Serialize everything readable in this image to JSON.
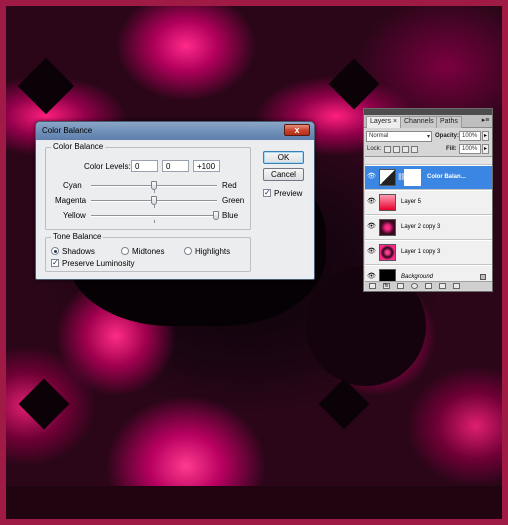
{
  "dialog": {
    "title": "Color Balance",
    "close_symbol": "x",
    "color_balance_group": "Color Balance",
    "color_levels_label": "Color Levels:",
    "levels": [
      "0",
      "0",
      "+100"
    ],
    "sliders": [
      {
        "left": "Cyan",
        "right": "Red",
        "value": 0
      },
      {
        "left": "Magenta",
        "right": "Green",
        "value": 0
      },
      {
        "left": "Yellow",
        "right": "Blue",
        "value": 100
      }
    ],
    "tone_balance_group": "Tone Balance",
    "tones": [
      {
        "label": "Shadows",
        "selected": true
      },
      {
        "label": "Midtones",
        "selected": false
      },
      {
        "label": "Highlights",
        "selected": false
      }
    ],
    "preserve_luminosity": {
      "label": "Preserve Luminosity",
      "checked": true
    },
    "buttons": {
      "ok": "OK",
      "cancel": "Cancel"
    },
    "preview": {
      "label": "Preview",
      "checked": true
    }
  },
  "layers_panel": {
    "tabs": [
      {
        "label": "Layers",
        "active": true
      },
      {
        "label": "Channels",
        "active": false
      },
      {
        "label": "Paths",
        "active": false
      }
    ],
    "menu_symbol": "▸≡",
    "blend_mode": "Normal",
    "opacity_label": "Opacity:",
    "opacity_value": "100%",
    "lock_label": "Lock:",
    "fill_label": "Fill:",
    "fill_value": "100%",
    "layers": [
      {
        "name": "Color Balan...",
        "selected": true,
        "thumb": "adjustment"
      },
      {
        "name": "Layer 5",
        "selected": false,
        "thumb": "red-gradient"
      },
      {
        "name": "Layer 2 copy 3",
        "selected": false,
        "thumb": "pink-pattern"
      },
      {
        "name": "Layer 1 copy 3",
        "selected": false,
        "thumb": "pink-pattern2"
      },
      {
        "name": "Background",
        "selected": false,
        "thumb": "black"
      }
    ],
    "bottom_icons": [
      "link",
      "fx",
      "mask",
      "adjust",
      "group",
      "new",
      "trash"
    ]
  },
  "colors": {
    "accent_selection": "#3b86e2",
    "artwork_pink": "#ff1f7e",
    "artwork_dark": "#060104",
    "frame": "#a01a46"
  }
}
